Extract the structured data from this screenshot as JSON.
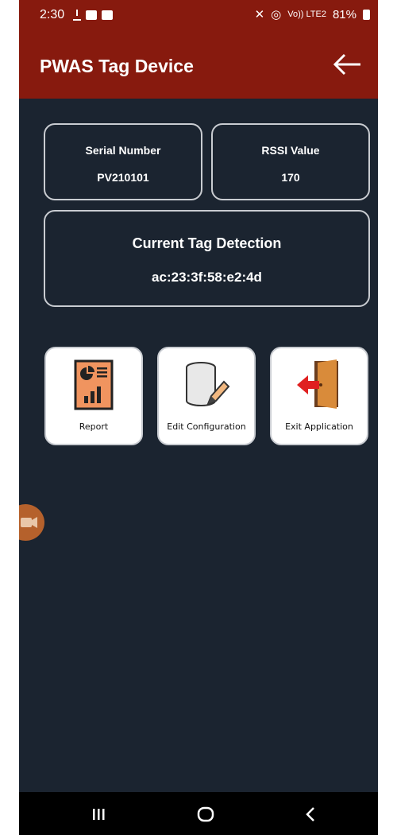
{
  "status_bar": {
    "time": "2:30",
    "right_text": "Vo)) LTE2",
    "battery": "81%"
  },
  "app_bar": {
    "title": "PWAS Tag Device",
    "back_icon": "arrow-left-icon"
  },
  "info": {
    "serial_label": "Serial Number",
    "serial_value": "PV210101",
    "rssi_label": "RSSI Value",
    "rssi_value": "170",
    "detection_label": "Current Tag Detection",
    "detection_value": "ac:23:3f:58:e2:4d"
  },
  "tiles": [
    {
      "label": "Report",
      "icon": "report-icon"
    },
    {
      "label": "Edit Configuration",
      "icon": "database-edit-icon"
    },
    {
      "label": "Exit Application",
      "icon": "exit-door-icon"
    }
  ],
  "nav": [
    {
      "icon": "recent-apps-icon"
    },
    {
      "icon": "home-icon"
    },
    {
      "icon": "back-chevron-icon"
    }
  ],
  "colors": {
    "app_bar": "#871a0e",
    "background": "#1b2430",
    "card_border": "#c9ccd1",
    "tile_bg": "#ffffff"
  }
}
